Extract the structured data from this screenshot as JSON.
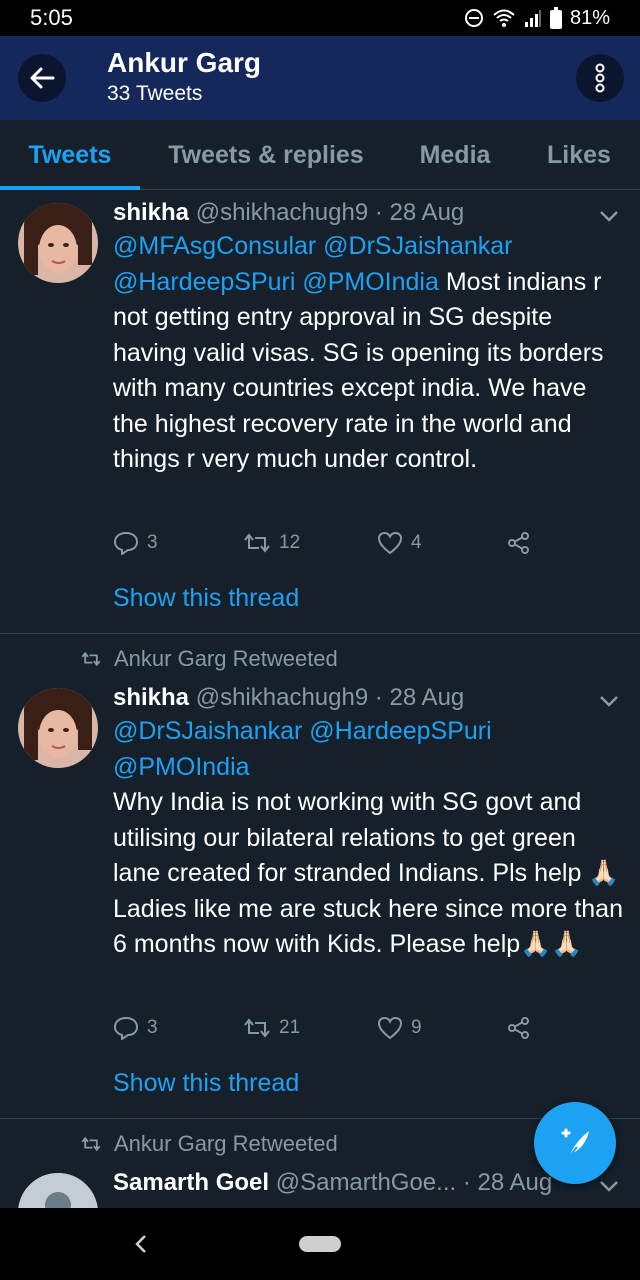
{
  "status_bar": {
    "time": "5:05",
    "battery": "81%"
  },
  "header": {
    "name": "Ankur Garg",
    "count": "33 Tweets"
  },
  "tabs": [
    {
      "label": "Tweets",
      "active": true
    },
    {
      "label": "Tweets & replies",
      "active": false
    },
    {
      "label": "Media",
      "active": false
    },
    {
      "label": "Likes",
      "active": false
    }
  ],
  "tweets": [
    {
      "display_name": "shikha",
      "handle": "@shikhachugh9",
      "date": "· 28 Aug",
      "mentions": "@MFAsgConsular @DrSJaishankar @HardeepSPuri @PMOIndia",
      "text": "Most indians r not getting entry approval in SG despite having valid visas. SG is opening its borders with many countries except india. We have the highest recovery rate in the world and things r very much under control.",
      "replies": "3",
      "retweets": "12",
      "likes": "4",
      "show_thread": "Show this thread"
    },
    {
      "retweeted_by": "Ankur Garg Retweeted",
      "display_name": "shikha",
      "handle": "@shikhachugh9",
      "date": "· 28 Aug",
      "mentions": "@DrSJaishankar @HardeepSPuri @PMOIndia",
      "text": "Why India is not working with SG govt and utilising our bilateral relations to get green lane created for stranded Indians. Pls help 🙏🏻Ladies like me are stuck here since more than 6 months now with Kids. Please help🙏🏻🙏🏻",
      "replies": "3",
      "retweets": "21",
      "likes": "9",
      "show_thread": "Show this thread"
    },
    {
      "retweeted_by": "Ankur Garg Retweeted",
      "display_name": "Samarth Goel",
      "handle": "@SamarthGoe...",
      "date": "· 28 Aug"
    }
  ],
  "colors": {
    "accent": "#1da1f2",
    "background": "#15202b",
    "header": "#14285b",
    "muted": "#8899a6"
  }
}
